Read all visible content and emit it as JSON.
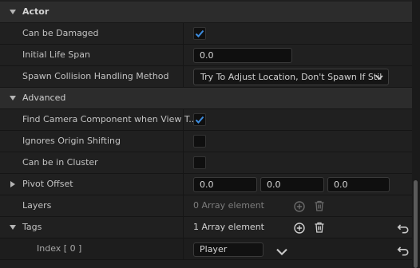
{
  "sections": {
    "actor": "Actor",
    "advanced": "Advanced"
  },
  "props": {
    "can_be_damaged": {
      "label": "Can be Damaged",
      "checked": true
    },
    "initial_life_span": {
      "label": "Initial Life Span",
      "value": "0.0"
    },
    "spawn_collision": {
      "label": "Spawn Collision Handling Method",
      "value": "Try To Adjust Location, Don't Spawn If Stil"
    },
    "find_camera": {
      "label": "Find Camera Component when View T...",
      "checked": true
    },
    "ignores_origin": {
      "label": "Ignores Origin Shifting",
      "checked": false
    },
    "can_be_in_cluster": {
      "label": "Can be in Cluster",
      "checked": false
    },
    "pivot_offset": {
      "label": "Pivot Offset",
      "x": "0.0",
      "y": "0.0",
      "z": "0.0"
    },
    "layers": {
      "label": "Layers",
      "value": "0 Array element"
    },
    "tags": {
      "label": "Tags",
      "value": "1 Array element"
    },
    "tags_index0": {
      "label": "Index [ 0 ]",
      "value": "Player"
    }
  },
  "colors": {
    "accent_check": "#3d8de0",
    "panel_bg": "#1f1f1f",
    "section_bg": "#2c2c2c"
  },
  "icons": [
    "collapse-triangle-icon",
    "expand-triangle-icon",
    "checkmark-icon",
    "chevron-down-icon",
    "add-element-icon",
    "delete-icon",
    "reset-to-default-icon"
  ]
}
